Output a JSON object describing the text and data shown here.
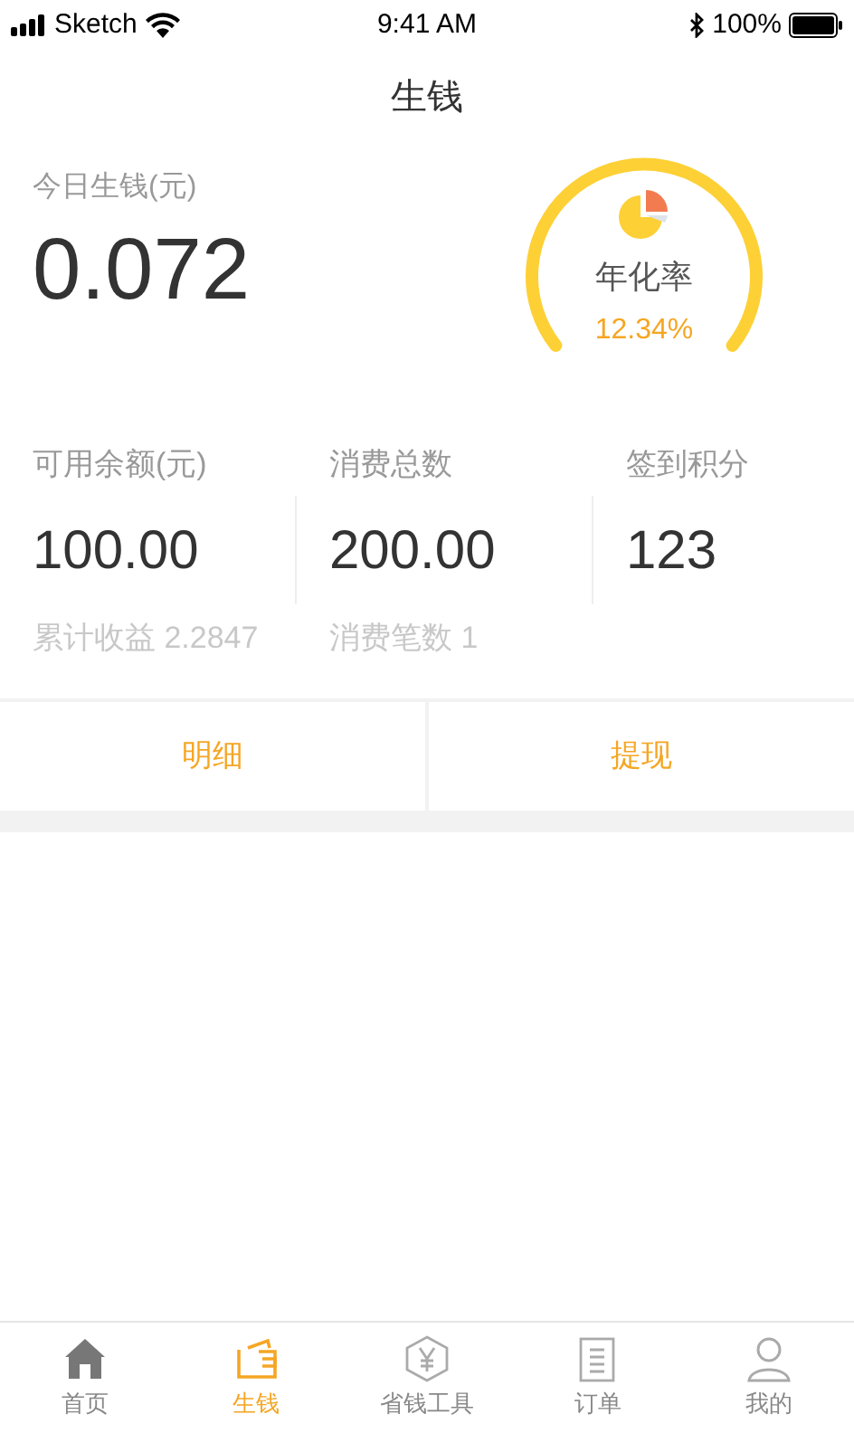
{
  "status_bar": {
    "carrier": "Sketch",
    "time": "9:41 AM",
    "battery": "100%"
  },
  "title": "生钱",
  "today": {
    "label": "今日生钱(元)",
    "value": "0.072"
  },
  "gauge": {
    "label": "年化率",
    "value": "12.34%"
  },
  "stats": [
    {
      "label": "可用余额(元)",
      "value": "100.00",
      "note": "累计收益 2.2847"
    },
    {
      "label": "消费总数",
      "value": "200.00",
      "note": "消费笔数 1"
    },
    {
      "label": "签到积分",
      "value": "123"
    }
  ],
  "actions": [
    "明细",
    "提现"
  ],
  "tabs": [
    {
      "label": "首页",
      "kind": "home",
      "selected": false
    },
    {
      "label": "生钱",
      "kind": "wallet",
      "selected": true
    },
    {
      "label": "省钱工具",
      "kind": "coin",
      "selected": false
    },
    {
      "label": "订单",
      "kind": "orders",
      "selected": false
    },
    {
      "label": "我的",
      "kind": "profile",
      "selected": false
    }
  ]
}
